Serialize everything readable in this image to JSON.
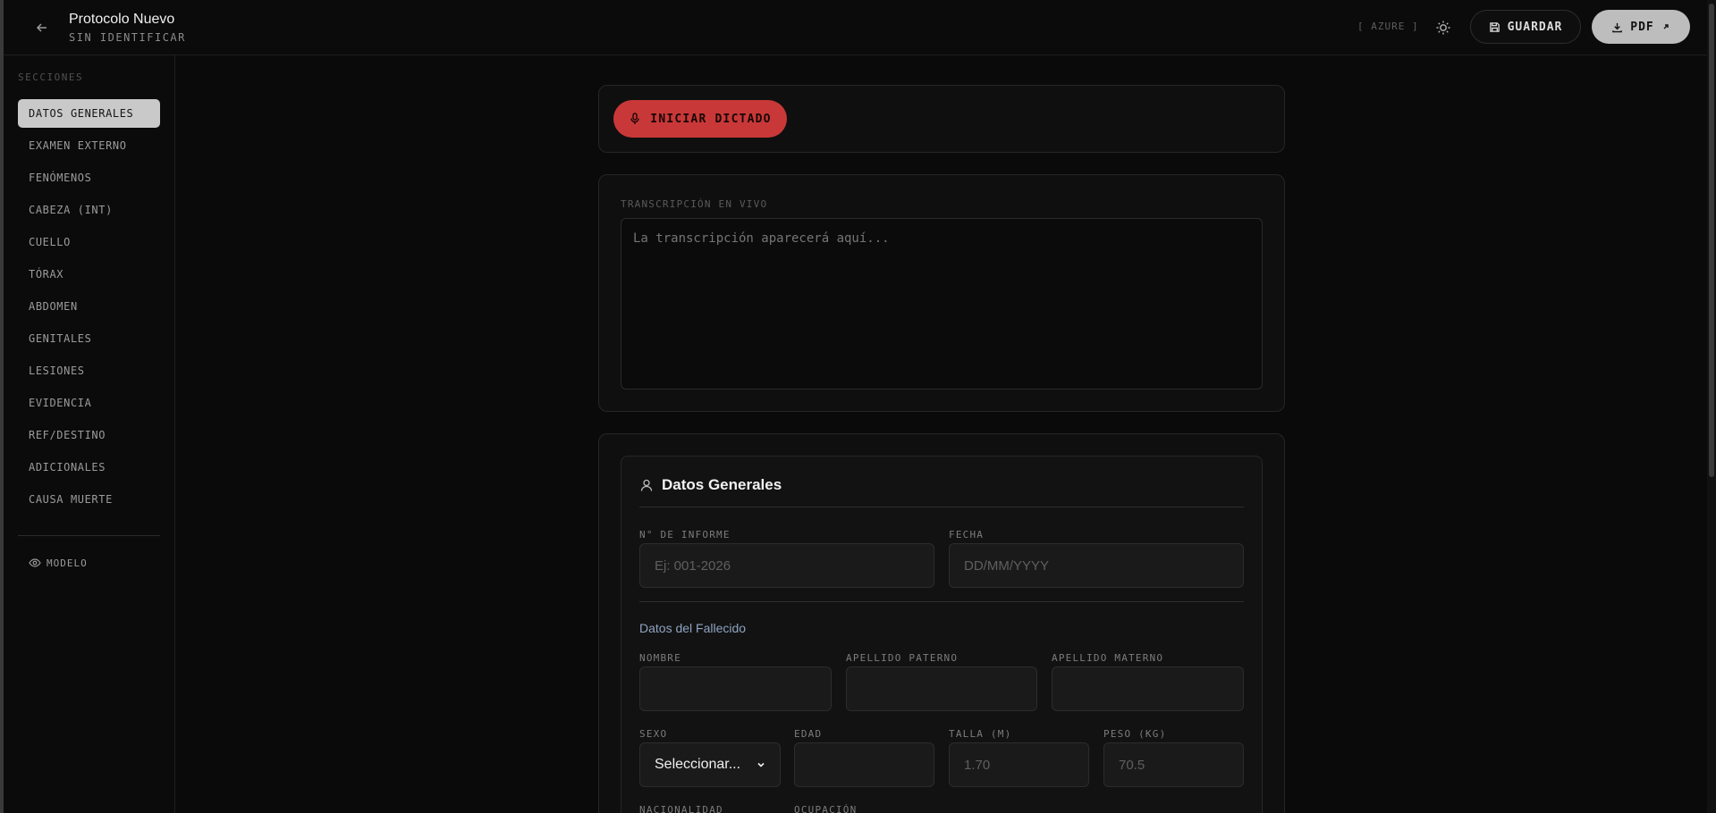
{
  "header": {
    "title": "Protocolo Nuevo",
    "subtitle": "SIN IDENTIFICAR",
    "provider": "[ AZURE ]",
    "save_label": "GUARDAR",
    "pdf_label": "PDF"
  },
  "sidebar": {
    "heading": "SECCIONES",
    "items": [
      {
        "label": "DATOS GENERALES",
        "active": true
      },
      {
        "label": "EXAMEN EXTERNO"
      },
      {
        "label": "FENÓMENOS"
      },
      {
        "label": "CABEZA (INT)"
      },
      {
        "label": "CUELLO"
      },
      {
        "label": "TÓRAX"
      },
      {
        "label": "ABDOMEN"
      },
      {
        "label": "GENITALES"
      },
      {
        "label": "LESIONES"
      },
      {
        "label": "EVIDENCIA"
      },
      {
        "label": "REF/DESTINO"
      },
      {
        "label": "ADICIONALES"
      },
      {
        "label": "CAUSA MUERTE"
      }
    ],
    "model_label": "MODELO"
  },
  "dictation": {
    "button_label": "INICIAR DICTADO"
  },
  "transcript": {
    "label": "TRANSCRIPCIÓN EN VIVO",
    "placeholder": "La transcripción aparecerá aquí..."
  },
  "form": {
    "section_title": "Datos Generales",
    "report_number": {
      "label": "N° DE INFORME",
      "placeholder": "Ej: 001-2026",
      "value": ""
    },
    "date": {
      "label": "FECHA",
      "placeholder": "DD/MM/YYYY",
      "value": ""
    },
    "subsection_title": "Datos del Fallecido",
    "first_name": {
      "label": "NOMBRE",
      "value": ""
    },
    "paternal_surname": {
      "label": "APELLIDO PATERNO",
      "value": ""
    },
    "maternal_surname": {
      "label": "APELLIDO MATERNO",
      "value": ""
    },
    "sex": {
      "label": "SEXO",
      "selected": "Seleccionar..."
    },
    "age": {
      "label": "EDAD",
      "value": ""
    },
    "height": {
      "label": "TALLA (M)",
      "placeholder": "1.70",
      "value": ""
    },
    "weight": {
      "label": "PESO (KG)",
      "placeholder": "70.5",
      "value": ""
    },
    "nationality": {
      "label": "NACIONALIDAD"
    },
    "occupation": {
      "label": "OCUPACIÓN"
    }
  }
}
